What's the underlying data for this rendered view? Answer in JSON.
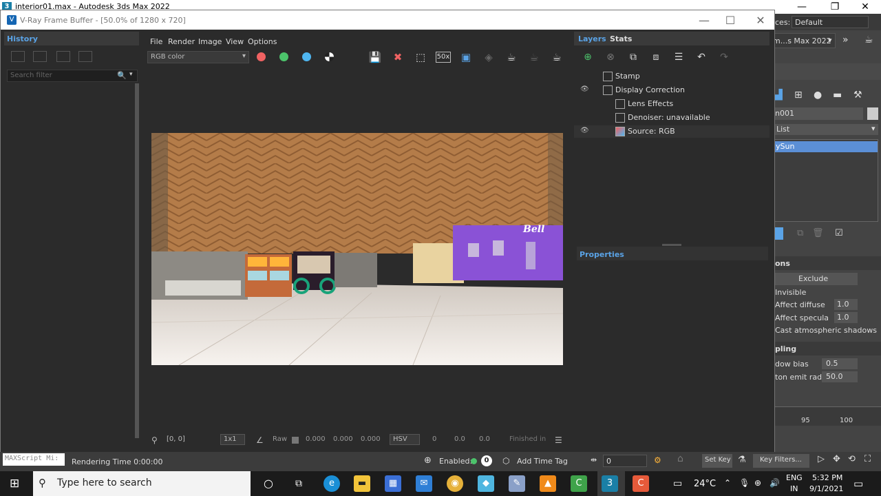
{
  "max_window": {
    "title": "interior01.max - Autodesk 3ds Max 2022",
    "workspaces_label": "ces:",
    "workspaces_value": "Default",
    "product_dropdown": "m...s Max 2022",
    "object_name": "n001",
    "list_label": "List",
    "selected_item": "ySun",
    "section_options": "ons",
    "exclude_button": "Exclude",
    "invisible_label": "Invisible",
    "affect_diffuse_label": "Affect diffuse",
    "affect_diffuse_value": "1.0",
    "affect_specular_label": "Affect specula",
    "affect_specular_value": "1.0",
    "cast_shadows_label": "Cast atmospheric shadows",
    "section_sampling": "pling",
    "shadow_bias_label": "dow bias",
    "shadow_bias_value": "0.5",
    "photon_radius_label": "ton emit radius",
    "photon_radius_value": "50.0",
    "ruler_95": "95",
    "ruler_100": "100",
    "set_key": "Set Key",
    "key_filters": "Key Filters..."
  },
  "vfb": {
    "title": "V-Ray Frame Buffer - [50.0% of 1280 x 720]",
    "history_tab": "History",
    "search_placeholder": "Search filter",
    "menu": [
      "File",
      "Render",
      "Image",
      "View",
      "Options"
    ],
    "channel": "RGB color",
    "zoom_label": "50x",
    "bottom": {
      "coords": "[0, 0]",
      "ratio": "1x1",
      "raw": "Raw",
      "v1": "0.000",
      "v2": "0.000",
      "v3": "0.000",
      "mode": "HSV",
      "h": "0",
      "s": "0.0",
      "v": "0.0",
      "status": "Finished in"
    },
    "layers_tab": "Layers",
    "stats_tab": "Stats",
    "layers": [
      "Stamp",
      "Display Correction",
      "Lens Effects",
      "Denoiser: unavailable",
      "Source: RGB"
    ],
    "properties_tab": "Properties"
  },
  "statusbar": {
    "maxscript": "MAXScript Mi:",
    "rendering_time": "Rendering Time  0:00:00",
    "enabled": "Enabled:",
    "add_time_tag": "Add Time Tag",
    "frame": "0"
  },
  "taskbar": {
    "search_placeholder": "Type here to search",
    "weather": "24°C",
    "lang1": "ENG",
    "lang2": "IN",
    "time": "5:32 PM",
    "date": "9/1/2021"
  },
  "colors": {
    "accent": "#5aa3e6",
    "red_dot": "#f06262",
    "green_dot": "#4cc36b",
    "blue_dot": "#4fb6f0"
  }
}
